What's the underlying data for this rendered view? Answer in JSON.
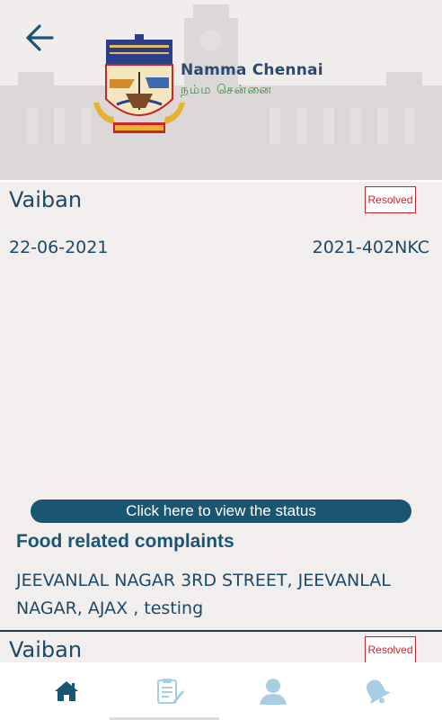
{
  "header": {
    "brand_en": "Namma Chennai",
    "brand_ta": "நம்ம சென்னை"
  },
  "complaints": [
    {
      "name": "Vaiban",
      "status": "Resolved",
      "date": "22-06-2021",
      "complaint_id": "2021-402NKC",
      "status_button": "Click here to view the status",
      "category": "Food related complaints",
      "address": "JEEVANLAL NAGAR 3RD STREET, JEEVANLAL NAGAR, AJAX , testing"
    },
    {
      "name": "Vaiban",
      "status": "Resolved"
    }
  ],
  "nav": {
    "items": [
      "home-icon",
      "complaint-form-icon",
      "profile-icon",
      "notification-bell-icon"
    ],
    "active": "home-icon"
  },
  "colors": {
    "primary": "#1a5672",
    "resolved": "#c8242a",
    "nav_active": "#1a5672",
    "nav_inactive": "#a9cde3"
  }
}
